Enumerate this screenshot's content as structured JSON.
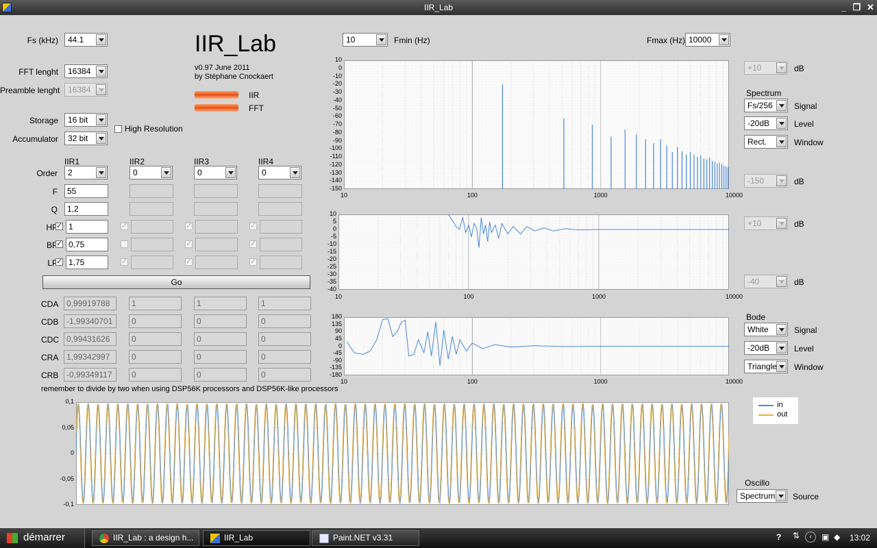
{
  "window": {
    "title": "IIR_Lab"
  },
  "app": {
    "title": "IIR_Lab",
    "version": "v0.97 June 2011",
    "author": "by Stéphane Cnockaert",
    "iir_led": "IIR",
    "fft_led": "FFT"
  },
  "settings": {
    "fs_label": "Fs (kHz)",
    "fs_value": "44.1",
    "fft_label": "FFT lenght",
    "fft_value": "16384",
    "preamble_label": "Preamble lenght",
    "preamble_value": "16384",
    "storage_label": "Storage",
    "storage_value": "16 bit",
    "accumulator_label": "Accumulator",
    "accumulator_value": "32 bit",
    "high_res_label": "High Resolution"
  },
  "iir": {
    "headers": [
      "IIR1",
      "IIR2",
      "IIR3",
      "IIR4"
    ],
    "row_labels": {
      "order": "Order",
      "f": "F",
      "q": "Q",
      "hp": "HP",
      "bp": "BP",
      "lp": "LP"
    },
    "order": [
      "2",
      "0",
      "0",
      "0"
    ],
    "f": [
      "55",
      "",
      "",
      ""
    ],
    "q": [
      "1,2",
      "",
      "",
      ""
    ],
    "hp": [
      "1",
      "",
      "",
      ""
    ],
    "bp": [
      "0,75",
      "",
      "",
      ""
    ],
    "lp": [
      "1,75",
      "",
      "",
      ""
    ],
    "hp_checked": [
      true,
      true,
      true,
      true
    ],
    "bp_checked": [
      true,
      false,
      true,
      true
    ],
    "lp_checked": [
      true,
      true,
      true,
      true
    ],
    "go_label": "Go"
  },
  "coefs": {
    "labels": [
      "CDA",
      "CDB",
      "CDC",
      "CRA",
      "CRB"
    ],
    "values": [
      [
        "0,99919788",
        "1",
        "1",
        "1"
      ],
      [
        "-1,99340701",
        "0",
        "0",
        "0"
      ],
      [
        "0,99431626",
        "0",
        "0",
        "0"
      ],
      [
        "1,99342997",
        "0",
        "0",
        "0"
      ],
      [
        "-0,99349117",
        "0",
        "0",
        "0"
      ]
    ],
    "note": "remember to divide by two when using DSP56K processors and DSP56K-like processors"
  },
  "freq": {
    "fmin_label": "Fmin (Hz)",
    "fmin_value": "10",
    "fmax_label": "Fmax (Hz)",
    "fmax_value": "10000",
    "x_ticks": [
      "10",
      "100",
      "1000",
      "10000"
    ]
  },
  "spectrum_plot": {
    "y_ticks": [
      "10",
      "0",
      "-10",
      "-20",
      "-30",
      "-40",
      "-50",
      "-60",
      "-70",
      "-80",
      "-90",
      "-100",
      "-110",
      "-120",
      "-130",
      "-140",
      "-150"
    ],
    "top_db": "+10",
    "bottom_db": "-150",
    "db": "dB",
    "section_label": "Spectrum",
    "signal": "Fs/256",
    "signal_label": "Signal",
    "level": "-20dB",
    "level_label": "Level",
    "window": "Rect.",
    "window_label": "Window"
  },
  "mag_plot": {
    "y_ticks": [
      "10",
      "5",
      "0",
      "-5",
      "-10",
      "-15",
      "-20",
      "-25",
      "-30",
      "-35",
      "-40"
    ],
    "top_db": "+10",
    "bottom_db": "-40",
    "db": "dB"
  },
  "phase_plot": {
    "y_ticks": [
      "180",
      "135",
      "90",
      "45",
      "0",
      "-45",
      "-90",
      "-135",
      "-180"
    ],
    "section_label": "Bode",
    "signal": "White",
    "signal_label": "Signal",
    "level": "-20dB",
    "level_label": "Level",
    "window": "Triangle",
    "window_label": "Window"
  },
  "oscillo": {
    "y_ticks": [
      "0,1",
      "0,05",
      "0",
      "-0,05",
      "-0,1"
    ],
    "legend_in": "in",
    "legend_out": "out",
    "section_label": "Oscillo",
    "source": "Spectrum",
    "source_label": "Source"
  },
  "colors": {
    "trace": "#4a88d8",
    "out_trace": "#f0b030",
    "grid": "#d0d0d0"
  },
  "chart_data": [
    {
      "type": "line",
      "title": "",
      "xlabel": "",
      "ylabel": "",
      "x_scale": "log",
      "xlim": [
        10,
        10000
      ],
      "ylim": [
        -150,
        10
      ],
      "series": [
        {
          "values": [
            [
              172,
              -20
            ],
            [
              517,
              -62
            ],
            [
              861,
              -70
            ],
            [
              1206,
              -85
            ],
            [
              1550,
              -76
            ],
            [
              1895,
              -82
            ],
            [
              2239,
              -88
            ],
            [
              2584,
              -93
            ],
            [
              2928,
              -88
            ],
            [
              3273,
              -96
            ],
            [
              3617,
              -104
            ],
            [
              3962,
              -98
            ],
            [
              4306,
              -103
            ],
            [
              4651,
              -107
            ],
            [
              4995,
              -104
            ],
            [
              5340,
              -107
            ],
            [
              5684,
              -110
            ],
            [
              6029,
              -108
            ],
            [
              6373,
              -112
            ],
            [
              6718,
              -113
            ],
            [
              7062,
              -111
            ],
            [
              7407,
              -115
            ],
            [
              7751,
              -116
            ],
            [
              8096,
              -118
            ],
            [
              8440,
              -117
            ],
            [
              8785,
              -119
            ],
            [
              9129,
              -121
            ],
            [
              9474,
              -122
            ],
            [
              9818,
              -123
            ]
          ]
        }
      ]
    },
    {
      "type": "line",
      "title": "",
      "xlabel": "",
      "ylabel": "",
      "x_scale": "log",
      "xlim": [
        10,
        10000
      ],
      "ylim": [
        -40,
        10
      ],
      "series": [
        {
          "values": [
            [
              70,
              10
            ],
            [
              75,
              6
            ],
            [
              80,
              2
            ],
            [
              85,
              0
            ],
            [
              90,
              8
            ],
            [
              95,
              -2
            ],
            [
              100,
              3
            ],
            [
              105,
              -5
            ],
            [
              110,
              4
            ],
            [
              115,
              1
            ],
            [
              120,
              -12
            ],
            [
              125,
              8
            ],
            [
              130,
              -3
            ],
            [
              135,
              3
            ],
            [
              140,
              -8
            ],
            [
              145,
              5
            ],
            [
              150,
              -2
            ],
            [
              160,
              3
            ],
            [
              170,
              -6
            ],
            [
              180,
              4
            ],
            [
              200,
              -3
            ],
            [
              220,
              2
            ],
            [
              250,
              -3
            ],
            [
              280,
              2
            ],
            [
              320,
              -1
            ],
            [
              380,
              1
            ],
            [
              450,
              -1
            ],
            [
              550,
              0.5
            ],
            [
              700,
              -0.3
            ],
            [
              1000,
              0
            ],
            [
              2000,
              0
            ],
            [
              10000,
              0
            ]
          ]
        }
      ]
    },
    {
      "type": "line",
      "title": "",
      "xlabel": "",
      "ylabel": "",
      "x_scale": "log",
      "xlim": [
        10,
        10000
      ],
      "ylim": [
        -180,
        180
      ],
      "series": [
        {
          "values": [
            [
              10.5,
              30
            ],
            [
              12,
              -40
            ],
            [
              14,
              -50
            ],
            [
              16,
              -30
            ],
            [
              18,
              40
            ],
            [
              20,
              165
            ],
            [
              22,
              170
            ],
            [
              24,
              60
            ],
            [
              26,
              90
            ],
            [
              28,
              150
            ],
            [
              30,
              160
            ],
            [
              32,
              -60
            ],
            [
              35,
              -50
            ],
            [
              38,
              40
            ],
            [
              42,
              -40
            ],
            [
              45,
              90
            ],
            [
              48,
              -60
            ],
            [
              52,
              150
            ],
            [
              56,
              -120
            ],
            [
              60,
              100
            ],
            [
              65,
              -80
            ],
            [
              70,
              60
            ],
            [
              75,
              -50
            ],
            [
              80,
              40
            ],
            [
              90,
              -30
            ],
            [
              100,
              20
            ],
            [
              120,
              -15
            ],
            [
              150,
              10
            ],
            [
              200,
              -5
            ],
            [
              300,
              3
            ],
            [
              500,
              -1
            ],
            [
              1000,
              0
            ],
            [
              10000,
              0
            ]
          ]
        }
      ]
    },
    {
      "type": "line",
      "title": "",
      "xlabel": "",
      "ylabel": "",
      "xlim": [
        0,
        1
      ],
      "ylim": [
        -0.1,
        0.1
      ],
      "series": [
        {
          "name": "in",
          "values": []
        },
        {
          "name": "out",
          "values": []
        }
      ]
    }
  ],
  "taskbar": {
    "start": "démarrer",
    "tasks": [
      "IIR_Lab : a design h...",
      "IIR_Lab",
      "Paint.NET v3.31"
    ],
    "clock": "13:02"
  }
}
